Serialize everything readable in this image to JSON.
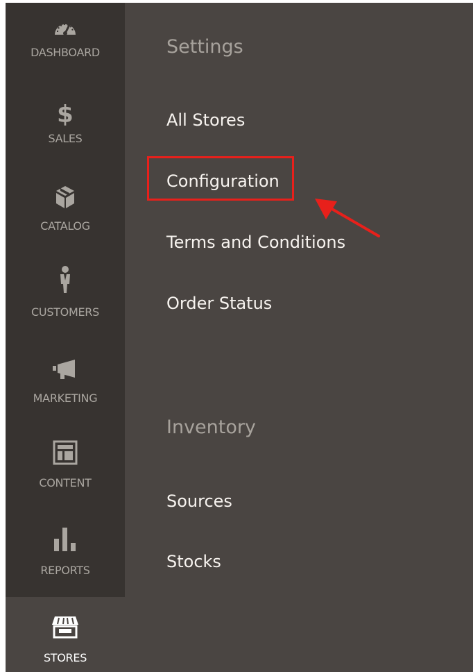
{
  "sidebar": {
    "items": [
      {
        "label": "DASHBOARD",
        "icon": "gauge-icon"
      },
      {
        "label": "SALES",
        "icon": "dollar-icon"
      },
      {
        "label": "CATALOG",
        "icon": "box-icon"
      },
      {
        "label": "CUSTOMERS",
        "icon": "person-icon"
      },
      {
        "label": "MARKETING",
        "icon": "megaphone-icon"
      },
      {
        "label": "CONTENT",
        "icon": "layout-icon"
      },
      {
        "label": "REPORTS",
        "icon": "bar-chart-icon"
      },
      {
        "label": "STORES",
        "icon": "storefront-icon",
        "active": true
      }
    ]
  },
  "submenu": {
    "settings": {
      "title": "Settings",
      "items": [
        "All Stores",
        "Configuration",
        "Terms and Conditions",
        "Order Status"
      ]
    },
    "inventory": {
      "title": "Inventory",
      "items": [
        "Sources",
        "Stocks"
      ]
    }
  },
  "colors": {
    "sidebar_bg": "#373330",
    "panel_bg": "#4a4542",
    "highlight": "#e8201b",
    "link_text": "#f7f3ef",
    "section_title": "#a7a29c"
  }
}
